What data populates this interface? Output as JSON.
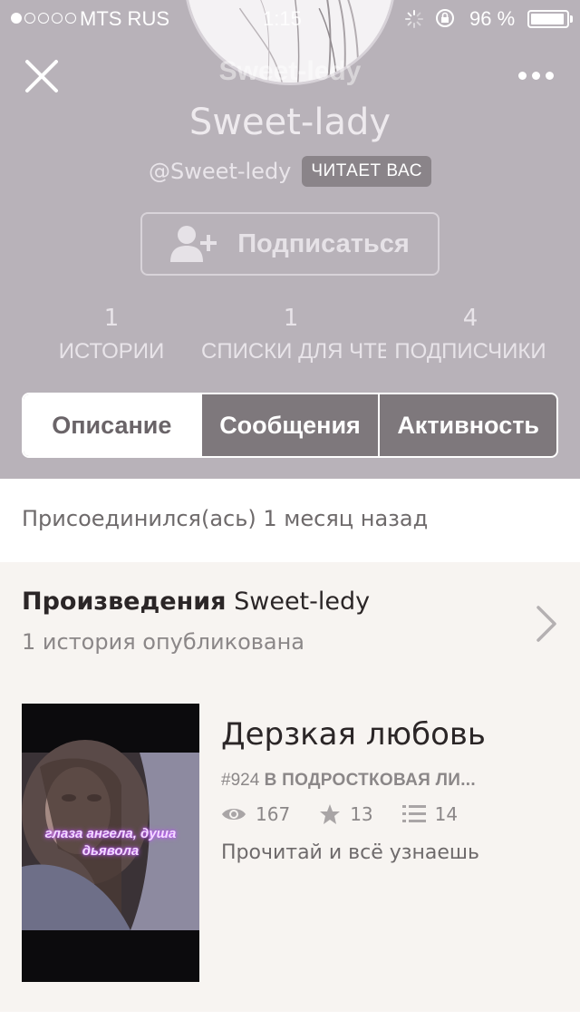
{
  "statusbar": {
    "carrier": "MTS RUS",
    "time": "1:15",
    "battery_pct": "96 %"
  },
  "profile": {
    "ghost_name": "Sweet-ledy",
    "display_name": "Sweet-lady",
    "username": "@Sweet-ledy",
    "follows_badge": "ЧИТАЕТ ВАС",
    "follow_label": "Подписаться"
  },
  "stats": [
    {
      "value": "1",
      "label": "ИСТОРИИ"
    },
    {
      "value": "1",
      "label": "СПИСКИ ДЛЯ ЧТЕНИЯ"
    },
    {
      "value": "4",
      "label": "ПОДПИСЧИКИ"
    }
  ],
  "tabs": [
    {
      "label": "Описание",
      "active": true
    },
    {
      "label": "Сообщения",
      "active": false
    },
    {
      "label": "Активность",
      "active": false
    }
  ],
  "joined": "Присоединился(ась) 1 месяц назад",
  "works": {
    "title_bold": "Произведения",
    "title_user": "Sweet-ledy",
    "subtitle": "1 история опубликована"
  },
  "story": {
    "title": "Дерзкая любовь",
    "rank": "#924",
    "category": "В ПОДРОСТКОВАЯ ЛИ...",
    "views": "167",
    "votes": "13",
    "parts": "14",
    "description": "Прочитай и всё узнаешь",
    "cover_caption": "глаза ангела, душа дьявола"
  },
  "colors": {
    "header_bg": "#b8b2b9",
    "tab_inactive": "#7e787c",
    "works_bg": "#f7f4f1"
  }
}
